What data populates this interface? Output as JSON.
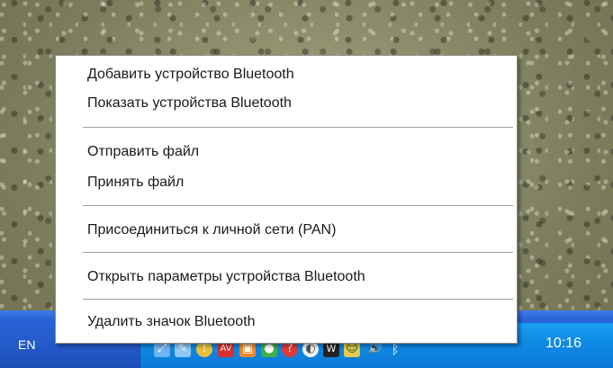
{
  "menu": {
    "items": [
      {
        "label": "Добавить устройство Bluetooth"
      },
      {
        "label": "Показать устройства Bluetooth"
      },
      {
        "label": "Отправить файл"
      },
      {
        "label": "Принять файл"
      },
      {
        "label": "Присоединиться к личной сети (PAN)"
      },
      {
        "label": "Открыть параметры устройства Bluetooth"
      },
      {
        "label": "Удалить значок Bluetooth"
      }
    ]
  },
  "taskbar": {
    "language": "EN",
    "clock": "10:16"
  },
  "colors": {
    "taskbar": "#2459c9",
    "tray": "#0f8ce6",
    "menu_background": "#ffffff",
    "separator": "#a0a0a0"
  },
  "tray_icons": [
    "network-icon",
    "pen-icon",
    "shield-icon",
    "antivirus-icon",
    "monitor-icon",
    "chat-icon",
    "help-icon",
    "update-icon",
    "download-icon",
    "messenger-icon",
    "volume-icon",
    "bluetooth-icon"
  ]
}
